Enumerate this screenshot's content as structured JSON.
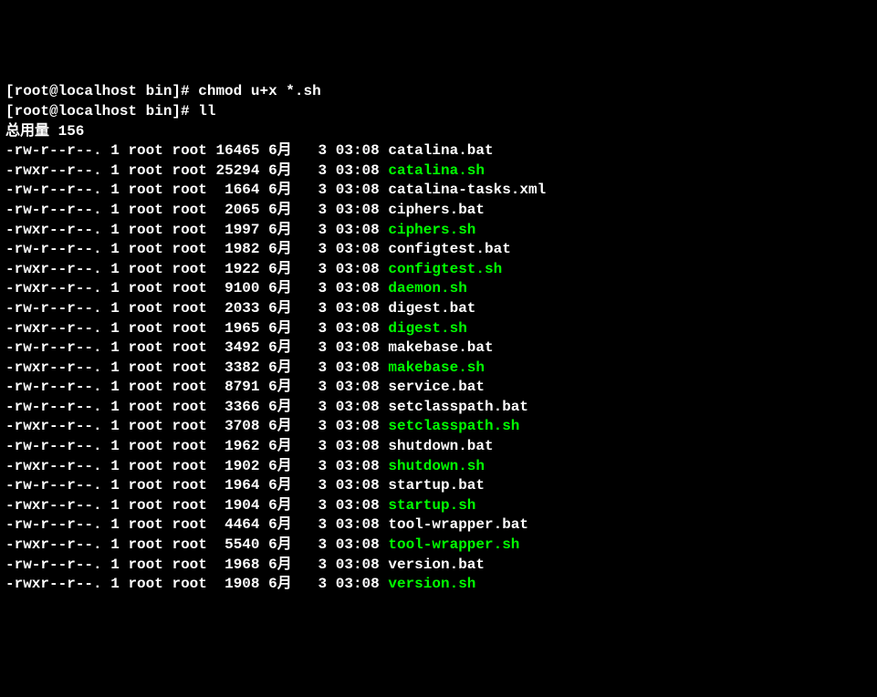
{
  "prompt1": {
    "user_host": "[root@localhost bin]#",
    "command": "chmod u+x *.sh"
  },
  "prompt2": {
    "user_host": "[root@localhost bin]#",
    "command": "ll"
  },
  "total_line": "总用量 156",
  "files": [
    {
      "perms": "-rw-r--r--.",
      "links": "1",
      "owner": "root",
      "group": "root",
      "size": "16465",
      "month": "6月",
      "day": "  3",
      "time": "03:08",
      "name": "catalina.bat",
      "executable": false
    },
    {
      "perms": "-rwxr--r--.",
      "links": "1",
      "owner": "root",
      "group": "root",
      "size": "25294",
      "month": "6月",
      "day": "  3",
      "time": "03:08",
      "name": "catalina.sh",
      "executable": true
    },
    {
      "perms": "-rw-r--r--.",
      "links": "1",
      "owner": "root",
      "group": "root",
      "size": " 1664",
      "month": "6月",
      "day": "  3",
      "time": "03:08",
      "name": "catalina-tasks.xml",
      "executable": false
    },
    {
      "perms": "-rw-r--r--.",
      "links": "1",
      "owner": "root",
      "group": "root",
      "size": " 2065",
      "month": "6月",
      "day": "  3",
      "time": "03:08",
      "name": "ciphers.bat",
      "executable": false
    },
    {
      "perms": "-rwxr--r--.",
      "links": "1",
      "owner": "root",
      "group": "root",
      "size": " 1997",
      "month": "6月",
      "day": "  3",
      "time": "03:08",
      "name": "ciphers.sh",
      "executable": true
    },
    {
      "perms": "-rw-r--r--.",
      "links": "1",
      "owner": "root",
      "group": "root",
      "size": " 1982",
      "month": "6月",
      "day": "  3",
      "time": "03:08",
      "name": "configtest.bat",
      "executable": false
    },
    {
      "perms": "-rwxr--r--.",
      "links": "1",
      "owner": "root",
      "group": "root",
      "size": " 1922",
      "month": "6月",
      "day": "  3",
      "time": "03:08",
      "name": "configtest.sh",
      "executable": true
    },
    {
      "perms": "-rwxr--r--.",
      "links": "1",
      "owner": "root",
      "group": "root",
      "size": " 9100",
      "month": "6月",
      "day": "  3",
      "time": "03:08",
      "name": "daemon.sh",
      "executable": true
    },
    {
      "perms": "-rw-r--r--.",
      "links": "1",
      "owner": "root",
      "group": "root",
      "size": " 2033",
      "month": "6月",
      "day": "  3",
      "time": "03:08",
      "name": "digest.bat",
      "executable": false
    },
    {
      "perms": "-rwxr--r--.",
      "links": "1",
      "owner": "root",
      "group": "root",
      "size": " 1965",
      "month": "6月",
      "day": "  3",
      "time": "03:08",
      "name": "digest.sh",
      "executable": true
    },
    {
      "perms": "-rw-r--r--.",
      "links": "1",
      "owner": "root",
      "group": "root",
      "size": " 3492",
      "month": "6月",
      "day": "  3",
      "time": "03:08",
      "name": "makebase.bat",
      "executable": false
    },
    {
      "perms": "-rwxr--r--.",
      "links": "1",
      "owner": "root",
      "group": "root",
      "size": " 3382",
      "month": "6月",
      "day": "  3",
      "time": "03:08",
      "name": "makebase.sh",
      "executable": true
    },
    {
      "perms": "-rw-r--r--.",
      "links": "1",
      "owner": "root",
      "group": "root",
      "size": " 8791",
      "month": "6月",
      "day": "  3",
      "time": "03:08",
      "name": "service.bat",
      "executable": false
    },
    {
      "perms": "-rw-r--r--.",
      "links": "1",
      "owner": "root",
      "group": "root",
      "size": " 3366",
      "month": "6月",
      "day": "  3",
      "time": "03:08",
      "name": "setclasspath.bat",
      "executable": false
    },
    {
      "perms": "-rwxr--r--.",
      "links": "1",
      "owner": "root",
      "group": "root",
      "size": " 3708",
      "month": "6月",
      "day": "  3",
      "time": "03:08",
      "name": "setclasspath.sh",
      "executable": true
    },
    {
      "perms": "-rw-r--r--.",
      "links": "1",
      "owner": "root",
      "group": "root",
      "size": " 1962",
      "month": "6月",
      "day": "  3",
      "time": "03:08",
      "name": "shutdown.bat",
      "executable": false
    },
    {
      "perms": "-rwxr--r--.",
      "links": "1",
      "owner": "root",
      "group": "root",
      "size": " 1902",
      "month": "6月",
      "day": "  3",
      "time": "03:08",
      "name": "shutdown.sh",
      "executable": true
    },
    {
      "perms": "-rw-r--r--.",
      "links": "1",
      "owner": "root",
      "group": "root",
      "size": " 1964",
      "month": "6月",
      "day": "  3",
      "time": "03:08",
      "name": "startup.bat",
      "executable": false
    },
    {
      "perms": "-rwxr--r--.",
      "links": "1",
      "owner": "root",
      "group": "root",
      "size": " 1904",
      "month": "6月",
      "day": "  3",
      "time": "03:08",
      "name": "startup.sh",
      "executable": true
    },
    {
      "perms": "-rw-r--r--.",
      "links": "1",
      "owner": "root",
      "group": "root",
      "size": " 4464",
      "month": "6月",
      "day": "  3",
      "time": "03:08",
      "name": "tool-wrapper.bat",
      "executable": false
    },
    {
      "perms": "-rwxr--r--.",
      "links": "1",
      "owner": "root",
      "group": "root",
      "size": " 5540",
      "month": "6月",
      "day": "  3",
      "time": "03:08",
      "name": "tool-wrapper.sh",
      "executable": true
    },
    {
      "perms": "-rw-r--r--.",
      "links": "1",
      "owner": "root",
      "group": "root",
      "size": " 1968",
      "month": "6月",
      "day": "  3",
      "time": "03:08",
      "name": "version.bat",
      "executable": false
    },
    {
      "perms": "-rwxr--r--.",
      "links": "1",
      "owner": "root",
      "group": "root",
      "size": " 1908",
      "month": "6月",
      "day": "  3",
      "time": "03:08",
      "name": "version.sh",
      "executable": true
    }
  ]
}
